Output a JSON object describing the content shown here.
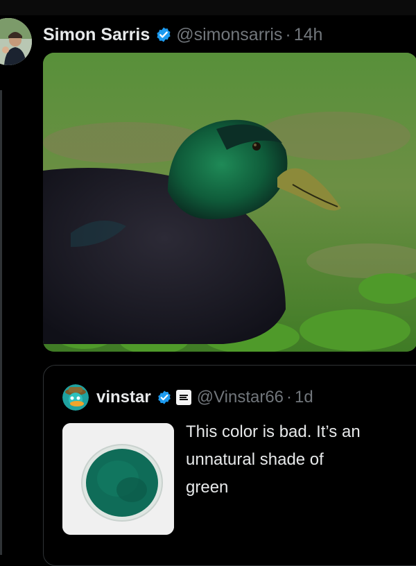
{
  "tweet": {
    "author_name": "Simon Sarris",
    "author_handle": "@simonsarris",
    "separator": "·",
    "time": "14h",
    "verified": true,
    "avatar_icon": "profile-photo",
    "media_alt": "duck-photo"
  },
  "quote": {
    "author_name": "vinstar",
    "author_handle": "@Vinstar66",
    "separator": "·",
    "time": "1d",
    "verified": true,
    "badge_icon": "affiliate-badge",
    "avatar_icon": "cartoon-avatar",
    "text": "This color is bad. It’s an\nunnatural shade of\ngreen",
    "thumb_alt": "green-pigment-dish"
  },
  "colors": {
    "verified_blue": "#1d9bf0",
    "handle_gray": "#71767b",
    "text": "#e7e9ea",
    "border": "#2f3336"
  }
}
